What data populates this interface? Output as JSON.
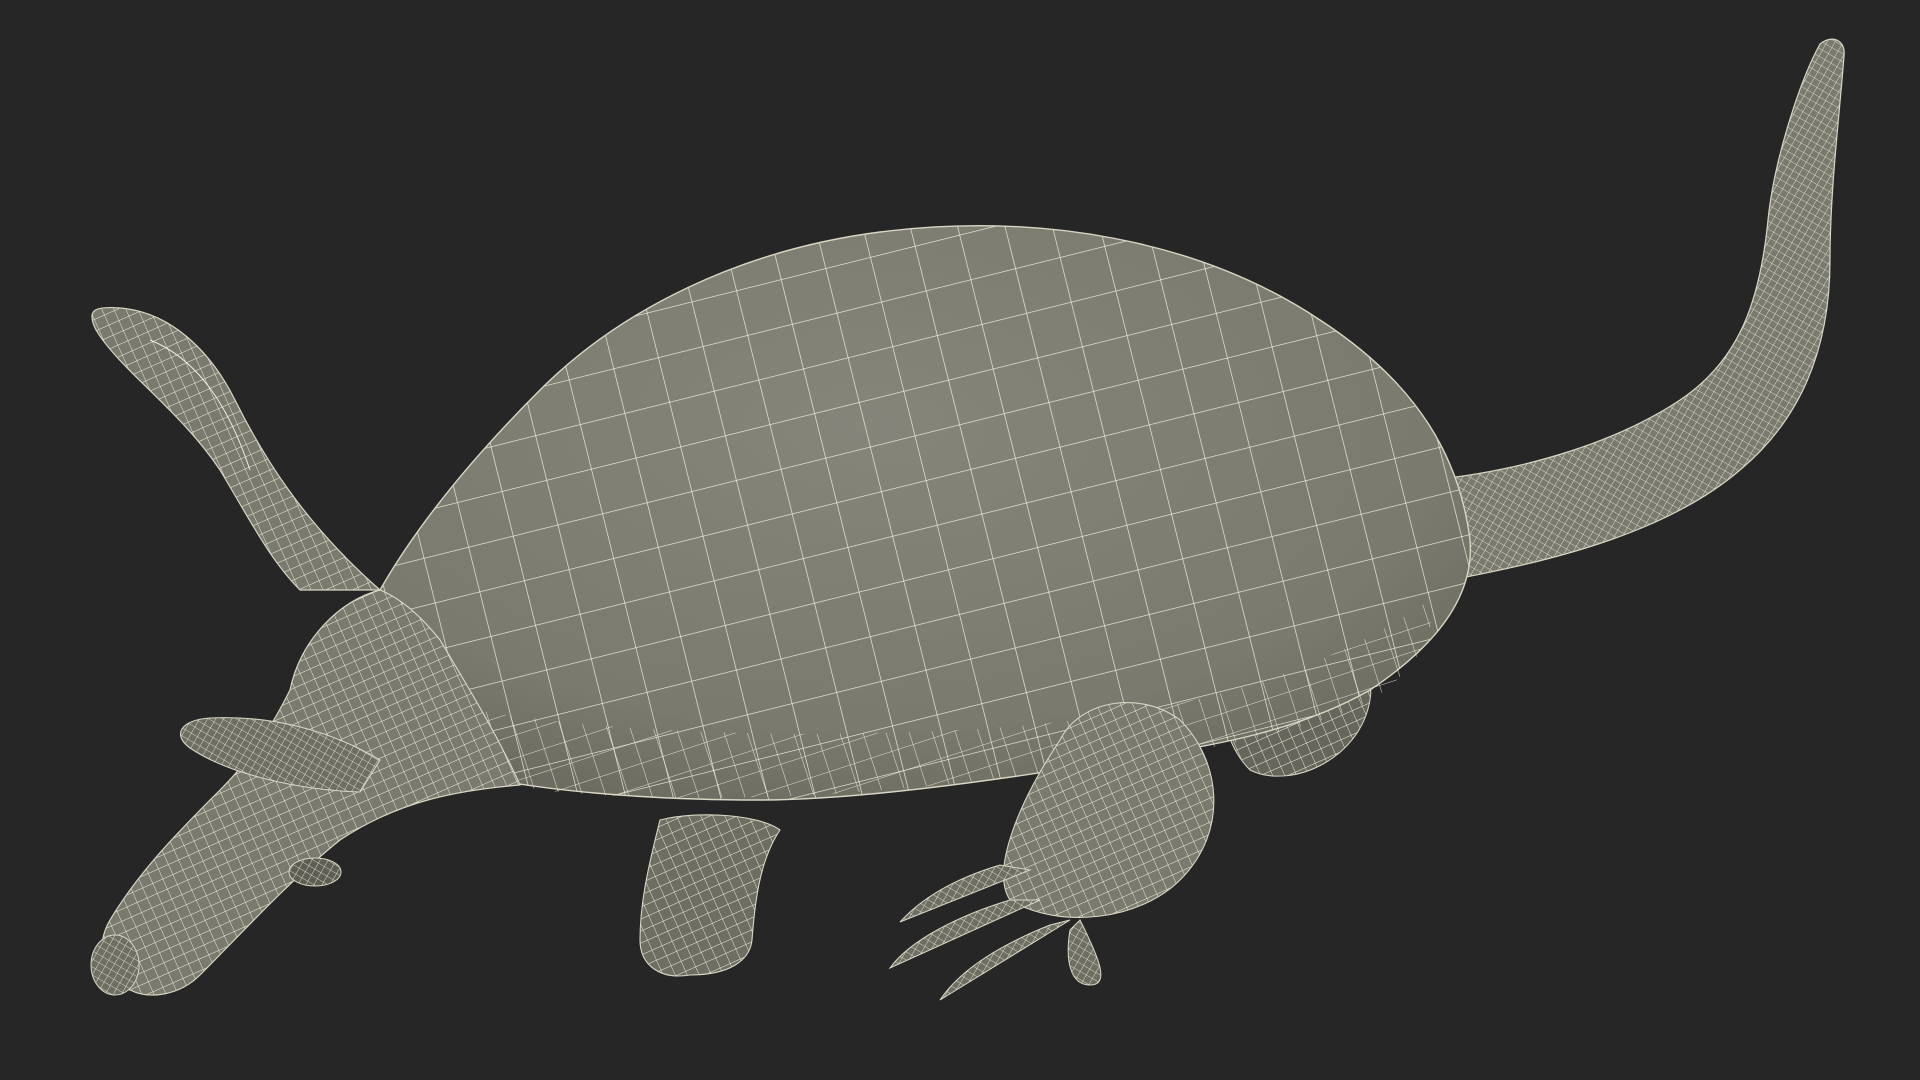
{
  "scene": {
    "subject": "aardvark-wireframe-model",
    "render_style": "wireframe",
    "colors": {
      "background": "#262626",
      "surface": "#7a7a6e",
      "surface_shadow": "#5e5e55",
      "surface_light": "#8a8a7e",
      "wire": "#f4f1df",
      "outline": "#d9d6c4"
    }
  }
}
